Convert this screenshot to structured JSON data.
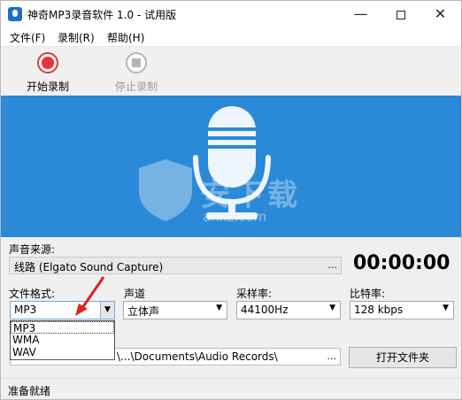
{
  "window": {
    "title": "神奇MP3录音软件 1.0 - 试用版",
    "minimize_glyph": "—",
    "close_glyph": "✕"
  },
  "menu": {
    "items": [
      "文件(F)",
      "录制(R)",
      "帮助(H)"
    ]
  },
  "toolbar": {
    "start_label": "开始录制",
    "stop_label": "停止录制"
  },
  "banner": {
    "background": "#2b8ad8",
    "watermark_text": "安下载",
    "watermark_domain": "anxz.com"
  },
  "source": {
    "label": "声音来源:",
    "value": "线路 (Elgato Sound Capture)",
    "browse": "..."
  },
  "timer": "00:00:00",
  "format": {
    "label": "文件格式:",
    "value": "MP3",
    "options": [
      "MP3",
      "WMA",
      "WAV"
    ]
  },
  "channel": {
    "label": "声道",
    "value": "立体声"
  },
  "samplerate": {
    "label": "采样率:",
    "value": "44100Hz"
  },
  "bitrate": {
    "label": "比特率:",
    "value": "128 kbps"
  },
  "output": {
    "path_visible": "\\...\\Documents\\Audio Records\\",
    "browse": "...",
    "open_folder": "打开文件夹"
  },
  "status": "准备就绪",
  "colors": {
    "record_red": "#e8333a",
    "banner_blue": "#2b8ad8",
    "annotation_red": "#e02020"
  }
}
